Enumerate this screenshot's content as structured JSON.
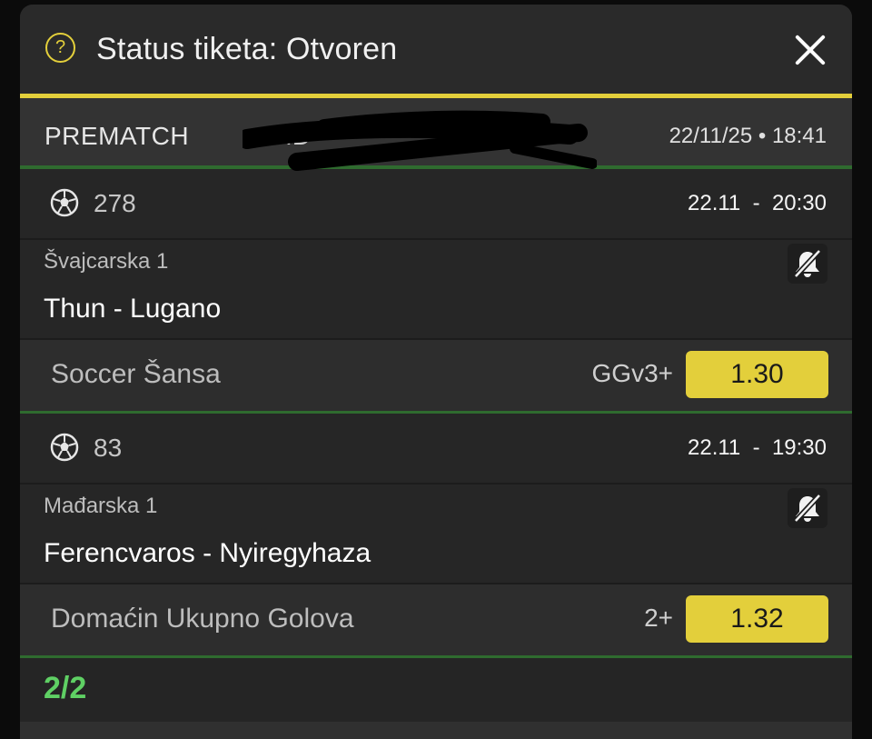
{
  "header": {
    "help_icon": "?",
    "title": "Status tiketa: Otvoren",
    "close_icon": "close-icon",
    "accent_color": "#e3cf3b"
  },
  "ticket": {
    "type": "PREMATCH",
    "id_label": "ID",
    "datetime": "22/11/25 • 18:41"
  },
  "events": [
    {
      "code": "278",
      "time": "22.11  -  20:30",
      "league": "Švajcarska 1",
      "teams": "Thun - Lugano",
      "market": "Soccer Šansa",
      "pick": "GGv3+",
      "odds": "1.30"
    },
    {
      "code": "83",
      "time": "22.11  -  19:30",
      "league": "Mađarska 1",
      "teams": "Ferencvaros - Nyiregyhaza",
      "market": "Domaćin Ukupno Golova",
      "pick": "2+",
      "odds": "1.32"
    }
  ],
  "footer": {
    "count": "2/2",
    "count_color": "#5fd064"
  }
}
